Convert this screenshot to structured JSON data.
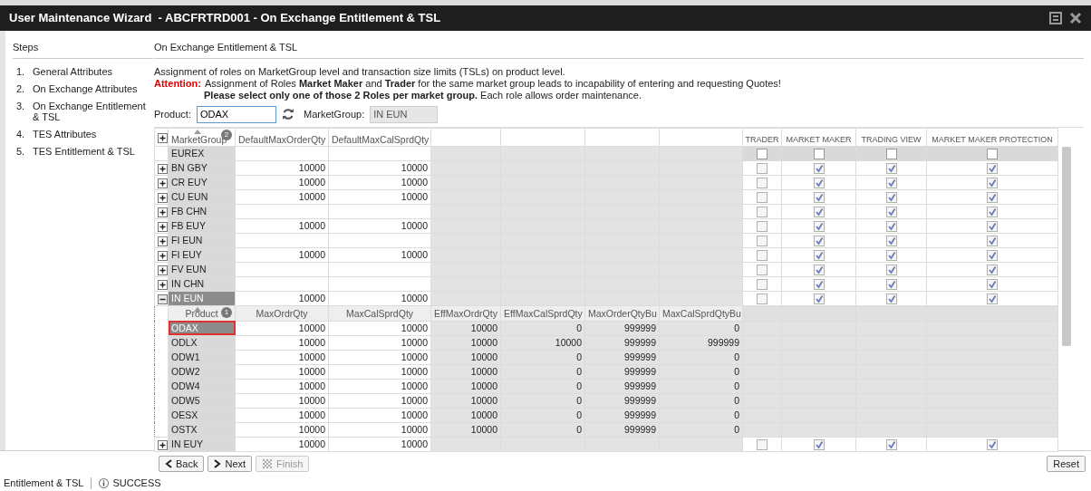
{
  "window": {
    "title": "User Maintenance Wizard  - ABCFRTRD001 - On Exchange Entitlement & TSL"
  },
  "steps": {
    "title": "Steps",
    "items": [
      {
        "number": "1.",
        "label": "General Attributes"
      },
      {
        "number": "2.",
        "label": "On Exchange Attributes"
      },
      {
        "number": "3.",
        "label": "On Exchange Entitlement & TSL"
      },
      {
        "number": "4.",
        "label": "TES Attributes"
      },
      {
        "number": "5.",
        "label": "TES Entitlement & TSL"
      }
    ]
  },
  "section_title": "On Exchange Entitlement & TSL",
  "info": {
    "line_1": "Assignment of roles on MarketGroup level and transaction size limits (TSLs) on product level.",
    "attention_label": "Attention:",
    "line_2": "Assignment of Roles **Market Maker** and **Trader** for the same market group leads to incapability of entering and requesting Quotes!",
    "line_3": "**Please select only one of those 2 Roles per market group.** Each role allows order maintenance."
  },
  "filter": {
    "product_label": "Product:",
    "product_value": "ODAX",
    "market_group_label": "MarketGroup:",
    "market_group_value": "IN EUN"
  },
  "grid": {
    "columns": [
      {
        "label": "MarketGroup",
        "sort_order": "2"
      },
      {
        "label": "DefaultMaxOrderQty"
      },
      {
        "label": "DefaultMaxCalSprdQty"
      }
    ],
    "role_columns": [
      "TRADER",
      "MARKET MAKER",
      "TRADING VIEW",
      "MARKET MAKER PROTECTION"
    ],
    "child_columns": [
      {
        "label": "Product",
        "sort_order": "1"
      },
      {
        "label": "MaxOrdrQty"
      },
      {
        "label": "MaxCalSprdQty"
      },
      {
        "label": "EffMaxOrdrQty"
      },
      {
        "label": "EffMaxCalSprdQty"
      },
      {
        "label": "MaxOrderQtyBu"
      },
      {
        "label": "MaxCalSprdQtyBu"
      }
    ],
    "rows": [
      {
        "name": "EUREX",
        "default_max_order_qty": "",
        "default_max_cal_sprd_qty": "",
        "selected": false,
        "roles": [
          {
            "checked": false,
            "disabled": false
          },
          {
            "checked": false,
            "disabled": false
          },
          {
            "checked": false,
            "disabled": false
          },
          {
            "checked": false,
            "disabled": false
          }
        ]
      },
      {
        "name": "BN GBY",
        "default_max_order_qty": "10000",
        "default_max_cal_sprd_qty": "10000",
        "expanded": false,
        "selected": false,
        "roles": [
          {
            "checked": false,
            "disabled": true
          },
          {
            "checked": true,
            "disabled": true
          },
          {
            "checked": true,
            "disabled": true
          },
          {
            "checked": true,
            "disabled": true
          }
        ]
      },
      {
        "name": "CR EUY",
        "default_max_order_qty": "10000",
        "default_max_cal_sprd_qty": "10000",
        "expanded": false,
        "selected": false,
        "roles": [
          {
            "checked": false,
            "disabled": true
          },
          {
            "checked": true,
            "disabled": true
          },
          {
            "checked": true,
            "disabled": true
          },
          {
            "checked": true,
            "disabled": true
          }
        ]
      },
      {
        "name": "CU EUN",
        "default_max_order_qty": "10000",
        "default_max_cal_sprd_qty": "10000",
        "expanded": false,
        "selected": false,
        "roles": [
          {
            "checked": false,
            "disabled": true
          },
          {
            "checked": true,
            "disabled": true
          },
          {
            "checked": true,
            "disabled": true
          },
          {
            "checked": true,
            "disabled": true
          }
        ]
      },
      {
        "name": "FB CHN",
        "default_max_order_qty": "",
        "default_max_cal_sprd_qty": "",
        "expanded": false,
        "selected": false,
        "roles": [
          {
            "checked": false,
            "disabled": true
          },
          {
            "checked": true,
            "disabled": true
          },
          {
            "checked": true,
            "disabled": true
          },
          {
            "checked": true,
            "disabled": true
          }
        ]
      },
      {
        "name": "FB EUY",
        "default_max_order_qty": "10000",
        "default_max_cal_sprd_qty": "10000",
        "expanded": false,
        "selected": false,
        "roles": [
          {
            "checked": false,
            "disabled": true
          },
          {
            "checked": true,
            "disabled": true
          },
          {
            "checked": true,
            "disabled": true
          },
          {
            "checked": true,
            "disabled": true
          }
        ]
      },
      {
        "name": "FI EUN",
        "default_max_order_qty": "",
        "default_max_cal_sprd_qty": "",
        "expanded": false,
        "selected": false,
        "roles": [
          {
            "checked": false,
            "disabled": true
          },
          {
            "checked": true,
            "disabled": true
          },
          {
            "checked": true,
            "disabled": true
          },
          {
            "checked": true,
            "disabled": true
          }
        ]
      },
      {
        "name": "FI EUY",
        "default_max_order_qty": "10000",
        "default_max_cal_sprd_qty": "10000",
        "expanded": false,
        "selected": false,
        "roles": [
          {
            "checked": false,
            "disabled": true
          },
          {
            "checked": true,
            "disabled": true
          },
          {
            "checked": true,
            "disabled": true
          },
          {
            "checked": true,
            "disabled": true
          }
        ]
      },
      {
        "name": "FV EUN",
        "default_max_order_qty": "",
        "default_max_cal_sprd_qty": "",
        "expanded": false,
        "selected": false,
        "roles": [
          {
            "checked": false,
            "disabled": true
          },
          {
            "checked": true,
            "disabled": true
          },
          {
            "checked": true,
            "disabled": true
          },
          {
            "checked": true,
            "disabled": true
          }
        ]
      },
      {
        "name": "IN CHN",
        "default_max_order_qty": "",
        "default_max_cal_sprd_qty": "",
        "expanded": false,
        "selected": false,
        "roles": [
          {
            "checked": false,
            "disabled": true
          },
          {
            "checked": true,
            "disabled": true
          },
          {
            "checked": true,
            "disabled": true
          },
          {
            "checked": true,
            "disabled": true
          }
        ]
      },
      {
        "name": "IN EUN",
        "default_max_order_qty": "10000",
        "default_max_cal_sprd_qty": "10000",
        "expanded": true,
        "selected": true,
        "roles": [
          {
            "checked": false,
            "disabled": true
          },
          {
            "checked": true,
            "disabled": true
          },
          {
            "checked": true,
            "disabled": true
          },
          {
            "checked": true,
            "disabled": true
          }
        ],
        "children": [
          {
            "values": [
              "ODAX",
              "10000",
              "10000",
              "10000",
              "0",
              "999999",
              "0"
            ],
            "selected": true
          },
          {
            "values": [
              "ODLX",
              "10000",
              "10000",
              "10000",
              "10000",
              "999999",
              "999999"
            ],
            "selected": false
          },
          {
            "values": [
              "ODW1",
              "10000",
              "10000",
              "10000",
              "0",
              "999999",
              "0"
            ],
            "selected": false
          },
          {
            "values": [
              "ODW2",
              "10000",
              "10000",
              "10000",
              "0",
              "999999",
              "0"
            ],
            "selected": false
          },
          {
            "values": [
              "ODW4",
              "10000",
              "10000",
              "10000",
              "0",
              "999999",
              "0"
            ],
            "selected": false
          },
          {
            "values": [
              "ODW5",
              "10000",
              "10000",
              "10000",
              "0",
              "999999",
              "0"
            ],
            "selected": false
          },
          {
            "values": [
              "OESX",
              "10000",
              "10000",
              "10000",
              "0",
              "999999",
              "0"
            ],
            "selected": false
          },
          {
            "values": [
              "OSTX",
              "10000",
              "10000",
              "10000",
              "0",
              "999999",
              "0"
            ],
            "selected": false
          }
        ]
      },
      {
        "name": "IN EUY",
        "default_max_order_qty": "10000",
        "default_max_cal_sprd_qty": "10000",
        "expanded": false,
        "selected": false,
        "roles": [
          {
            "checked": false,
            "disabled": true
          },
          {
            "checked": true,
            "disabled": true
          },
          {
            "checked": true,
            "disabled": true
          },
          {
            "checked": true,
            "disabled": true
          }
        ]
      }
    ]
  },
  "buttons": [
    {
      "label": "Back",
      "kind": "back",
      "disabled": false
    },
    {
      "label": "Next",
      "kind": "next",
      "disabled": false
    },
    {
      "label": "Finish",
      "kind": "finish",
      "disabled": true
    }
  ],
  "reset_button": "Reset",
  "status_bar": {
    "page": "Entitlement & TSL",
    "status": "SUCCESS"
  }
}
